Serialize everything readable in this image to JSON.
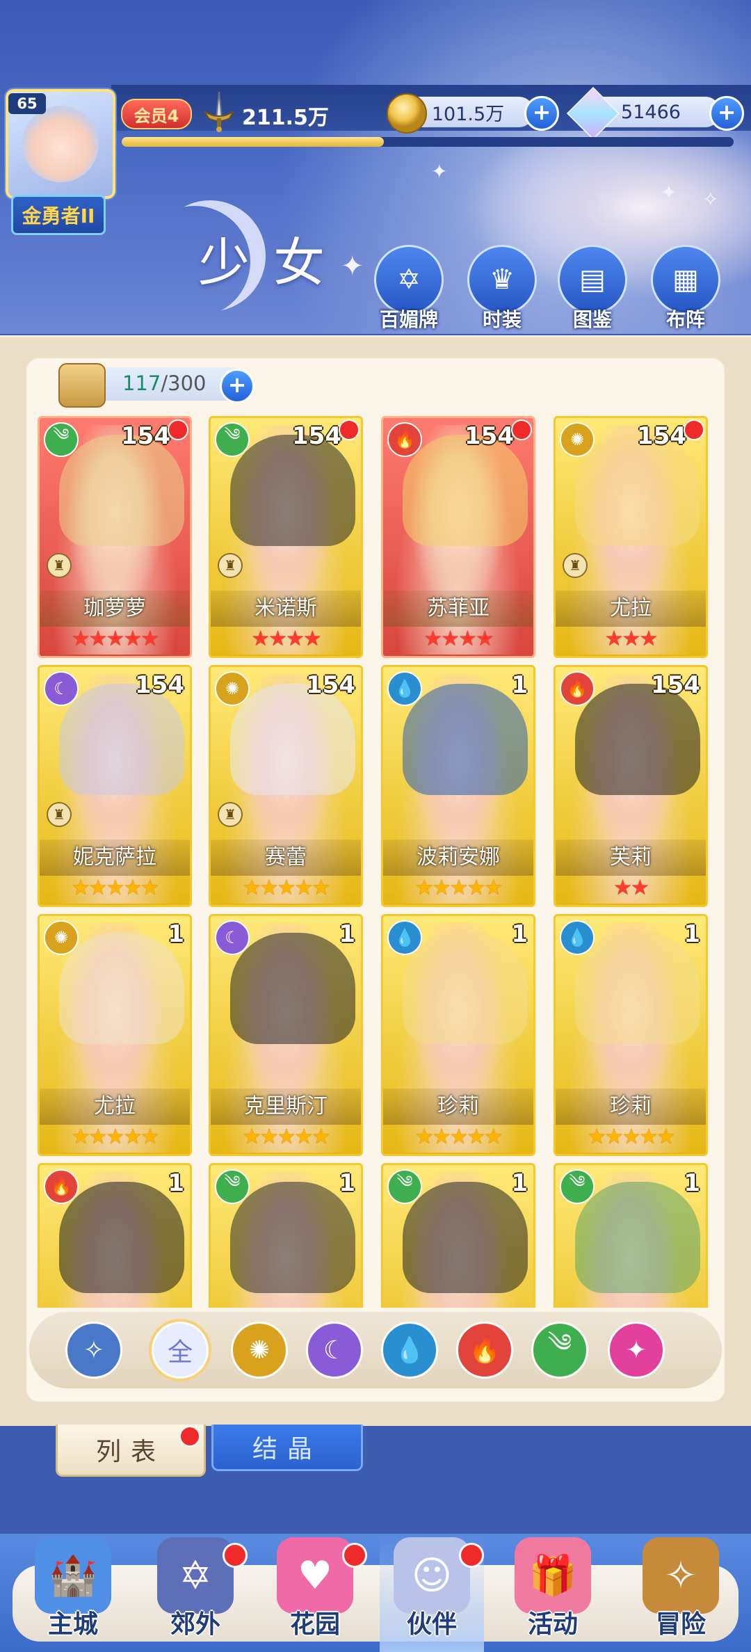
{
  "player": {
    "level": "65",
    "rank_title": "金勇者II",
    "vip_label": "会员4",
    "power": "211.5万",
    "exp_progress": 0.5
  },
  "resources": {
    "gold": "101.5万",
    "gems": "51466"
  },
  "page_title": "少女",
  "quick_actions": [
    {
      "label": "百媚牌",
      "icon": "card-icon"
    },
    {
      "label": "时装",
      "icon": "outfit-icon"
    },
    {
      "label": "图鉴",
      "icon": "book-icon"
    },
    {
      "label": "布阵",
      "icon": "formation-icon"
    }
  ],
  "capacity": {
    "current": "117",
    "max": "/300"
  },
  "element_colors": {
    "wind": "#3fae4e",
    "light": "#d8a21c",
    "moon": "#8a5bd6",
    "water": "#2a8fd1",
    "fire": "#e2433a",
    "star": "#e3409e",
    "all": "#6c78d8",
    "angel": "#4a78c8"
  },
  "cards": [
    {
      "name": "珈萝萝",
      "level": "154",
      "stars": 5,
      "star_color": "red",
      "element": "wind",
      "bg": "red",
      "dot": true,
      "chess": true
    },
    {
      "name": "米诺斯",
      "level": "154",
      "stars": 4,
      "star_color": "red",
      "element": "wind",
      "bg": "gold",
      "dot": true,
      "chess": true
    },
    {
      "name": "苏菲亚",
      "level": "154",
      "stars": 4,
      "star_color": "red",
      "element": "fire",
      "bg": "red",
      "dot": true,
      "chess": false
    },
    {
      "name": "尤拉",
      "level": "154",
      "stars": 3,
      "star_color": "red",
      "element": "light",
      "bg": "gold",
      "dot": true,
      "chess": true
    },
    {
      "name": "妮克萨拉",
      "level": "154",
      "stars": 5,
      "star_color": "gold",
      "element": "moon",
      "bg": "gold",
      "dot": false,
      "chess": true
    },
    {
      "name": "赛蕾",
      "level": "154",
      "stars": 5,
      "star_color": "gold",
      "element": "light",
      "bg": "gold",
      "dot": false,
      "chess": true
    },
    {
      "name": "波莉安娜",
      "level": "1",
      "stars": 5,
      "star_color": "gold",
      "element": "water",
      "bg": "gold",
      "dot": false,
      "chess": false
    },
    {
      "name": "芙莉",
      "level": "154",
      "stars": 2,
      "star_color": "red",
      "element": "fire",
      "bg": "gold",
      "dot": false,
      "chess": false
    },
    {
      "name": "尤拉",
      "level": "1",
      "stars": 5,
      "star_color": "gold",
      "element": "light",
      "bg": "gold",
      "dot": false,
      "chess": false
    },
    {
      "name": "克里斯汀",
      "level": "1",
      "stars": 5,
      "star_color": "gold",
      "element": "moon",
      "bg": "gold",
      "dot": false,
      "chess": false
    },
    {
      "name": "珍莉",
      "level": "1",
      "stars": 5,
      "star_color": "gold",
      "element": "water",
      "bg": "gold",
      "dot": false,
      "chess": false
    },
    {
      "name": "珍莉",
      "level": "1",
      "stars": 5,
      "star_color": "gold",
      "element": "water",
      "bg": "gold",
      "dot": false,
      "chess": false
    },
    {
      "name": "",
      "level": "1",
      "stars": 0,
      "star_color": "gold",
      "element": "fire",
      "bg": "gold",
      "dot": false,
      "chess": false
    },
    {
      "name": "",
      "level": "1",
      "stars": 0,
      "star_color": "gold",
      "element": "wind",
      "bg": "gold",
      "dot": false,
      "chess": false
    },
    {
      "name": "",
      "level": "1",
      "stars": 0,
      "star_color": "gold",
      "element": "wind",
      "bg": "gold",
      "dot": false,
      "chess": false
    },
    {
      "name": "",
      "level": "1",
      "stars": 0,
      "star_color": "gold",
      "element": "wind",
      "bg": "gold",
      "dot": false,
      "chess": false
    }
  ],
  "filters": [
    {
      "id": "angel",
      "label": "",
      "icon": "angel-icon"
    },
    {
      "id": "all",
      "label": "全",
      "icon": "all-icon",
      "selected": true
    },
    {
      "id": "light",
      "label": "",
      "icon": "light-icon"
    },
    {
      "id": "moon",
      "label": "",
      "icon": "moon-icon"
    },
    {
      "id": "water",
      "label": "",
      "icon": "water-icon"
    },
    {
      "id": "fire",
      "label": "",
      "icon": "fire-icon"
    },
    {
      "id": "wind",
      "label": "",
      "icon": "wind-icon"
    },
    {
      "id": "star",
      "label": "",
      "icon": "star-icon"
    }
  ],
  "tabs": {
    "list": "列表",
    "crystal": "结晶"
  },
  "bottom_nav": [
    {
      "label": "主城",
      "icon": "castle-icon",
      "dot": false
    },
    {
      "label": "郊外",
      "icon": "portal-icon",
      "dot": true
    },
    {
      "label": "花园",
      "icon": "heart-icon",
      "dot": true
    },
    {
      "label": "伙伴",
      "icon": "partner-icon",
      "dot": true,
      "active": true
    },
    {
      "label": "活动",
      "icon": "gift-icon",
      "dot": false
    },
    {
      "label": "冒险",
      "icon": "compass-icon",
      "dot": false
    }
  ]
}
